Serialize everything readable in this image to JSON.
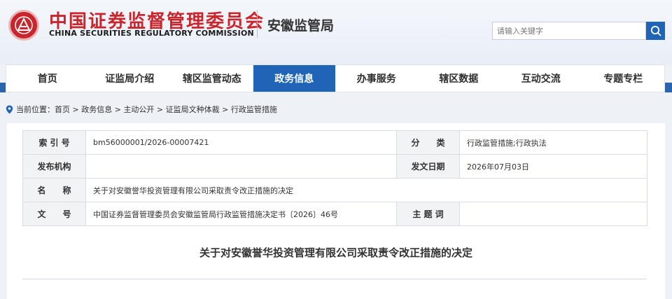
{
  "header": {
    "logo_cn": "中国证券监督管理委员会",
    "logo_en": "CHINA SECURITIES REGULATORY COMMISSION",
    "bureau": "安徽监管局",
    "search_placeholder": "请输入关键字",
    "emblem_icon": "csrc-emblem-icon",
    "search_icon": "magnifier-icon"
  },
  "nav": {
    "items": [
      "首页",
      "证监局介绍",
      "辖区监管动态",
      "政务信息",
      "办事服务",
      "辖区数据",
      "互动交流",
      "专题专栏"
    ],
    "active_index": 3
  },
  "breadcrumb": {
    "icon": "location-pin-icon",
    "prefix": "当前位置：",
    "items": [
      "首页",
      "政务信息",
      "主动公开",
      "证监局文种体裁",
      "行政监管措施"
    ],
    "separator": " > "
  },
  "meta": {
    "index_label": "索 引 号",
    "index_value": "bm56000001/2026-00007421",
    "category_label": "分　　类",
    "category_value": "行政监管措施;行政执法",
    "issuer_label": "发布机构",
    "issuer_value": "",
    "date_label": "发文日期",
    "date_value": "2026年07月03日",
    "name_label": "名　　称",
    "name_value": "关于对安徽誉华投资管理有限公司采取责令改正措施的决定",
    "docno_label": "文　　号",
    "docno_value": "中国证券监督管理委员会安徽监管局行政监管措施决定书〔2026〕46号",
    "keywords_label": "主 题 词",
    "keywords_value": ""
  },
  "document": {
    "title": "关于对安徽誉华投资管理有限公司采取责令改正措施的决定"
  },
  "colors": {
    "brand_red": "#c8262c",
    "nav_blue": "#1f64b6",
    "band_blue": "#2a64ad"
  }
}
